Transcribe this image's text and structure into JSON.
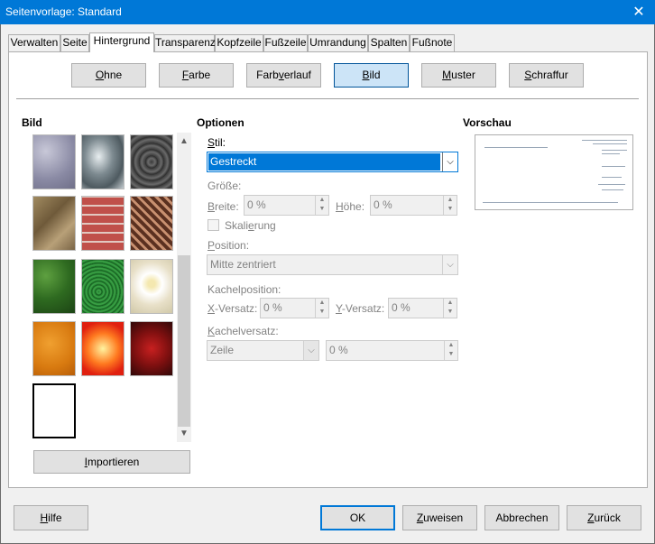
{
  "window": {
    "title": "Seitenvorlage: Standard"
  },
  "tabs": [
    {
      "label": "Verwalten"
    },
    {
      "label": "Seite"
    },
    {
      "label": "Hintergrund"
    },
    {
      "label": "Transparenz"
    },
    {
      "label": "Kopfzeile"
    },
    {
      "label": "Fußzeile"
    },
    {
      "label": "Umrandung"
    },
    {
      "label": "Spalten"
    },
    {
      "label": "Fußnote"
    }
  ],
  "fill_type": {
    "none": {
      "pre": "",
      "key": "O",
      "post": "hne"
    },
    "color": {
      "pre": "",
      "key": "F",
      "post": "arbe"
    },
    "gradient": {
      "pre": "Farb",
      "key": "v",
      "post": "erlauf"
    },
    "image": {
      "pre": "",
      "key": "B",
      "post": "ild"
    },
    "pattern": {
      "pre": "",
      "key": "M",
      "post": "uster"
    },
    "hatch": {
      "pre": "",
      "key": "S",
      "post": "chraffur"
    }
  },
  "image_section": {
    "heading": "Bild",
    "thumbnails": [
      {
        "name": "Aqua"
      },
      {
        "name": "Metall"
      },
      {
        "name": "Kiesel"
      },
      {
        "name": "Steine"
      },
      {
        "name": "Ziegel"
      },
      {
        "name": "Geflecht"
      },
      {
        "name": "Efeu"
      },
      {
        "name": "Gras"
      },
      {
        "name": "Gänseblümchen"
      },
      {
        "name": "Orange"
      },
      {
        "name": "Feuer"
      },
      {
        "name": "Rosen"
      },
      {
        "name": "Seite"
      }
    ],
    "import": {
      "pre": "",
      "key": "I",
      "post": "mportieren"
    }
  },
  "options": {
    "heading": "Optionen",
    "style_label": {
      "pre": "",
      "key": "S",
      "post": "til:"
    },
    "style_value": "Gestreckt",
    "size_label": "Größe:",
    "width_label": {
      "pre": "",
      "key": "B",
      "post": "reite:"
    },
    "width_value": "0 %",
    "height_label": {
      "pre": "",
      "key": "H",
      "post": "öhe:"
    },
    "height_value": "0 %",
    "scale_label": {
      "pre": "Skali",
      "key": "e",
      "post": "rung"
    },
    "position_label": {
      "pre": "",
      "key": "P",
      "post": "osition:"
    },
    "position_value": "Mitte zentriert",
    "tile_position_label": "Kachelposition:",
    "x_offset_label": {
      "pre": "",
      "key": "X",
      "post": "-Versatz:"
    },
    "x_offset_value": "0 %",
    "y_offset_label": {
      "pre": "",
      "key": "Y",
      "post": "-Versatz:"
    },
    "y_offset_value": "0 %",
    "tile_offset_label": {
      "pre": "",
      "key": "K",
      "post": "achelversatz:"
    },
    "tile_offset_mode": "Zeile",
    "tile_offset_value": "0 %"
  },
  "preview": {
    "heading": "Vorschau"
  },
  "footer": {
    "help": {
      "pre": "",
      "key": "H",
      "post": "ilfe"
    },
    "ok": "OK",
    "apply": {
      "pre": "",
      "key": "Z",
      "post": "uweisen"
    },
    "cancel": "Abbrechen",
    "reset": {
      "pre": "",
      "key": "Z",
      "post": "urück"
    }
  },
  "colors": {
    "accent": "#0078d7",
    "selected_button": "#cce4f7"
  }
}
